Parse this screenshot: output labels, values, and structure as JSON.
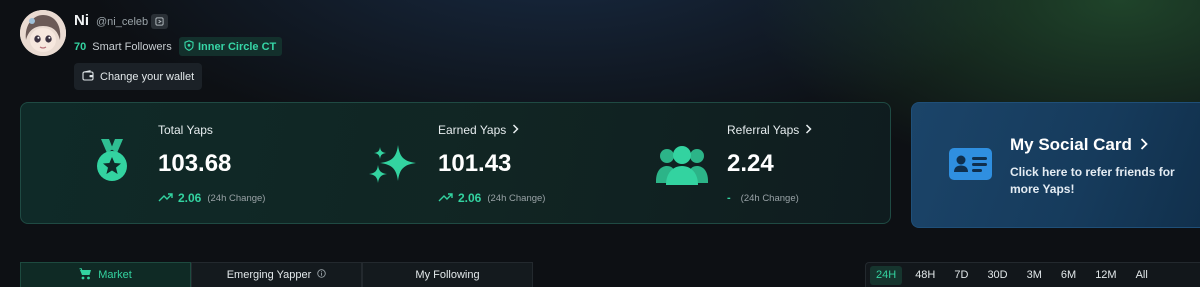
{
  "profile": {
    "name": "Ni",
    "handle": "@ni_celeb",
    "smart_followers_count": "70",
    "smart_followers_label": "Smart Followers",
    "badge_label": "Inner Circle CT",
    "wallet_button_label": "Change your wallet"
  },
  "stats": {
    "total": {
      "title": "Total Yaps",
      "value": "103.68",
      "change": "2.06",
      "change_note": "(24h Change)"
    },
    "earned": {
      "title": "Earned Yaps",
      "value": "101.43",
      "change": "2.06",
      "change_note": "(24h Change)"
    },
    "referral": {
      "title": "Referral Yaps",
      "value": "2.24",
      "change": "-",
      "change_note": "(24h Change)"
    }
  },
  "social_card": {
    "title": "My Social Card",
    "description": "Click here to refer friends for more Yaps!"
  },
  "tabs": [
    {
      "label": "Market",
      "active": true
    },
    {
      "label": "Emerging Yapper",
      "active": false
    },
    {
      "label": "My Following",
      "active": false
    }
  ],
  "ranges": [
    "24H",
    "48H",
    "7D",
    "30D",
    "3M",
    "6M",
    "12M",
    "All"
  ],
  "selected_range": "24H",
  "colors": {
    "accent": "#33d3a0",
    "card_blue": "#1b4469",
    "panel_green": "#0f2a28"
  },
  "icons": {
    "handle": "copy-icon",
    "badge": "shield-icon",
    "wallet": "wallet-icon",
    "total": "medal-icon",
    "earned": "sparkles-icon",
    "referral": "users-icon",
    "social": "id-card-icon",
    "market_tab": "market-icon",
    "emerging_tab": "info-icon"
  }
}
